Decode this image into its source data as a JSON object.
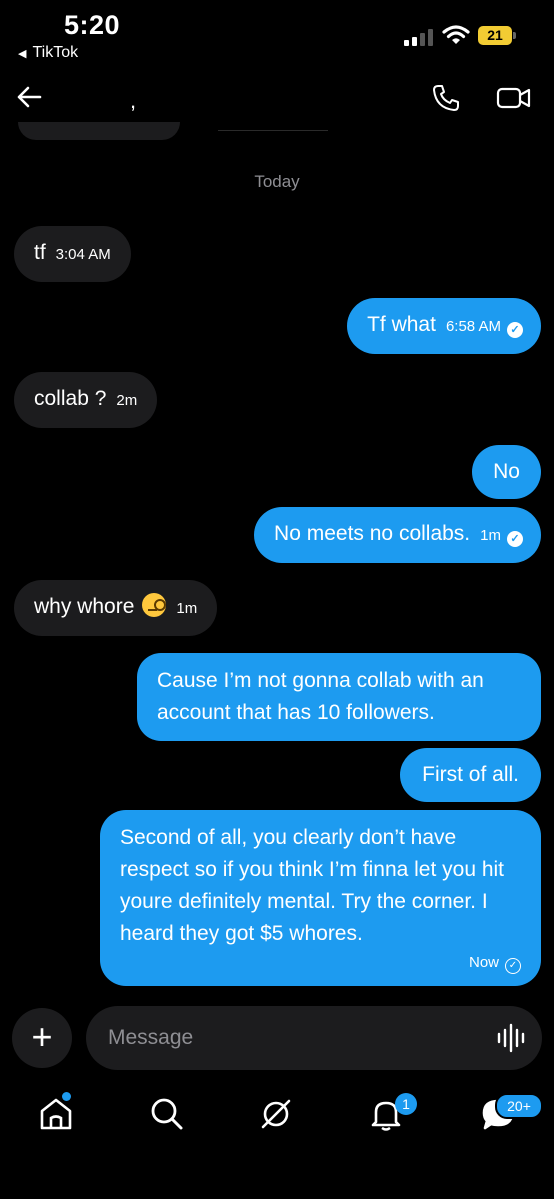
{
  "status_bar": {
    "time": "5:20",
    "back_app": "TikTok",
    "battery": "21"
  },
  "header": {
    "contact_name": ","
  },
  "date_separator": "Today",
  "messages": [
    {
      "dir": "in",
      "text": "tf",
      "meta": "3:04 AM"
    },
    {
      "dir": "out",
      "text": "Tf what",
      "meta": "6:58 AM"
    },
    {
      "dir": "in",
      "text": "collab ?",
      "meta": "2m"
    },
    {
      "dir": "out",
      "text": "No",
      "meta": ""
    },
    {
      "dir": "out",
      "text": "No meets no collabs.",
      "meta": "1m"
    },
    {
      "dir": "in",
      "text": "why whore",
      "meta": "1m",
      "emoji": "face-with-monocle"
    },
    {
      "dir": "out",
      "text": "Cause I’m not gonna collab with an account that has 10 followers.",
      "meta": ""
    },
    {
      "dir": "out",
      "text": "First of all.",
      "meta": ""
    },
    {
      "dir": "out",
      "text": "Second of all, you clearly don’t have respect so if you think I’m finna let you hit youre definitely mental. Try the corner. I heard they got $5 whores.",
      "meta": "Now"
    }
  ],
  "composer": {
    "placeholder": "Message"
  },
  "tab_bar": {
    "items": [
      "home-icon",
      "search-icon",
      "explore-icon",
      "notifications-icon",
      "messages-icon"
    ],
    "notifications_badge": "1",
    "messages_badge": "20+"
  },
  "colors": {
    "background": "#000000",
    "incoming_bubble": "#1c1c1e",
    "outgoing_bubble": "#1d9bf0",
    "battery": "#f2cc33"
  }
}
